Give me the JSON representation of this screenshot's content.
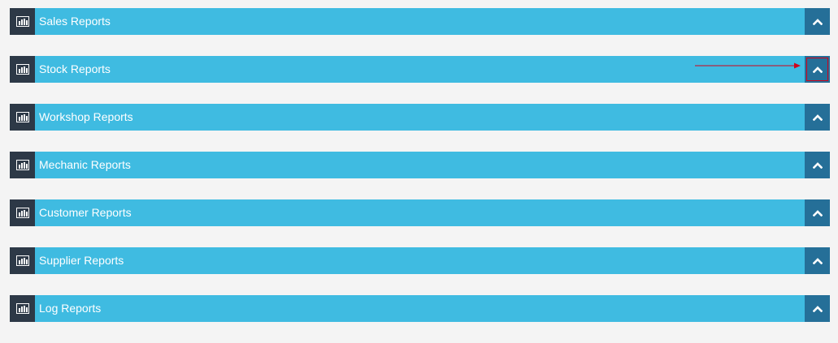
{
  "colors": {
    "page_bg": "#f4f4f4",
    "panel_bg": "#3fbbe1",
    "icon_box_bg": "#2d3947",
    "toggle_bg": "#256f98",
    "text": "#ffffff",
    "annotation": "#d0021b"
  },
  "icons": {
    "panel_icon": "bar-chart-icon",
    "toggle_icon": "chevron-up-icon",
    "annotation": "red-arrow"
  },
  "panels": [
    {
      "title": "Sales Reports",
      "expanded": false
    },
    {
      "title": "Stock Reports",
      "expanded": false,
      "highlighted": true
    },
    {
      "title": "Workshop Reports",
      "expanded": false
    },
    {
      "title": "Mechanic Reports",
      "expanded": false
    },
    {
      "title": "Customer Reports",
      "expanded": false
    },
    {
      "title": "Supplier Reports",
      "expanded": false
    },
    {
      "title": "Log Reports",
      "expanded": false
    }
  ]
}
